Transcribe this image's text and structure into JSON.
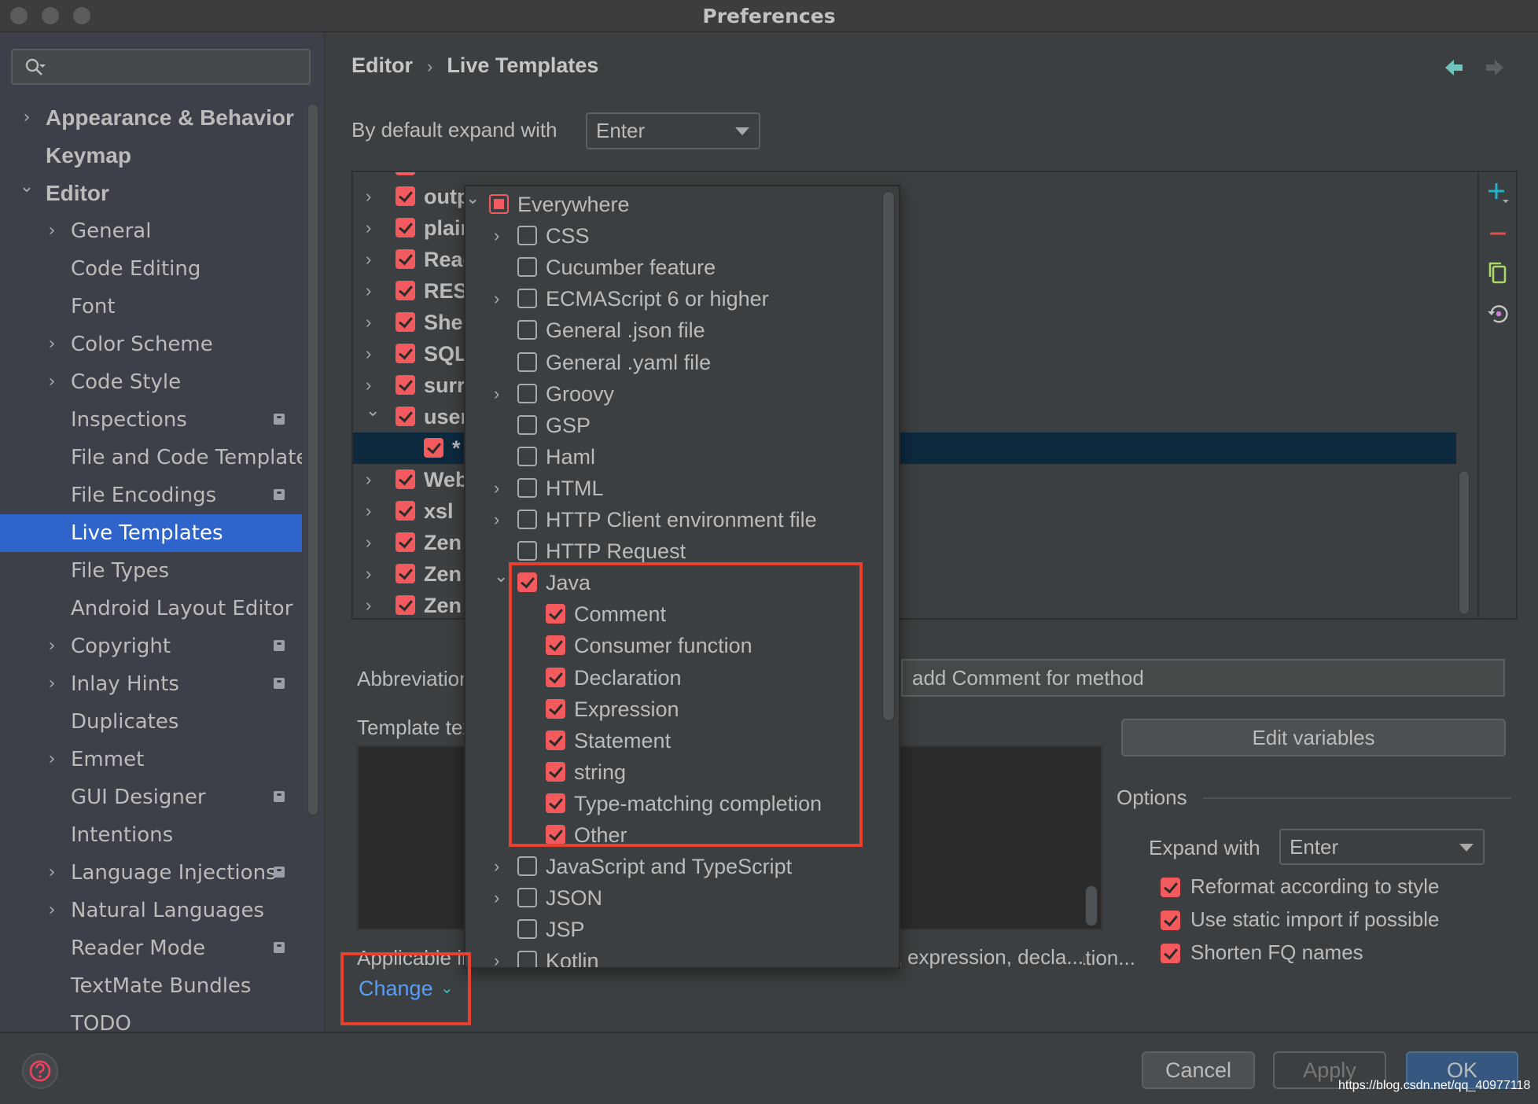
{
  "window": {
    "title": "Preferences"
  },
  "sidebar": {
    "search_placeholder": "",
    "items": [
      {
        "label": "Appearance & Behavior",
        "level": 0,
        "expander": "collapsed",
        "bold": true,
        "badge": false
      },
      {
        "label": "Keymap",
        "level": 0,
        "expander": "none",
        "bold": true,
        "badge": false
      },
      {
        "label": "Editor",
        "level": 0,
        "expander": "expanded",
        "bold": true,
        "badge": false
      },
      {
        "label": "General",
        "level": 1,
        "expander": "collapsed",
        "bold": false,
        "badge": false
      },
      {
        "label": "Code Editing",
        "level": 1,
        "expander": "none",
        "bold": false,
        "badge": false
      },
      {
        "label": "Font",
        "level": 1,
        "expander": "none",
        "bold": false,
        "badge": false
      },
      {
        "label": "Color Scheme",
        "level": 1,
        "expander": "collapsed",
        "bold": false,
        "badge": false
      },
      {
        "label": "Code Style",
        "level": 1,
        "expander": "collapsed",
        "bold": false,
        "badge": false
      },
      {
        "label": "Inspections",
        "level": 1,
        "expander": "none",
        "bold": false,
        "badge": true
      },
      {
        "label": "File and Code Templates",
        "level": 1,
        "expander": "none",
        "bold": false,
        "badge": false
      },
      {
        "label": "File Encodings",
        "level": 1,
        "expander": "none",
        "bold": false,
        "badge": true
      },
      {
        "label": "Live Templates",
        "level": 1,
        "expander": "none",
        "bold": false,
        "badge": false,
        "selected": true
      },
      {
        "label": "File Types",
        "level": 1,
        "expander": "none",
        "bold": false,
        "badge": false
      },
      {
        "label": "Android Layout Editor",
        "level": 1,
        "expander": "none",
        "bold": false,
        "badge": false
      },
      {
        "label": "Copyright",
        "level": 1,
        "expander": "collapsed",
        "bold": false,
        "badge": true
      },
      {
        "label": "Inlay Hints",
        "level": 1,
        "expander": "collapsed",
        "bold": false,
        "badge": true
      },
      {
        "label": "Duplicates",
        "level": 1,
        "expander": "none",
        "bold": false,
        "badge": false
      },
      {
        "label": "Emmet",
        "level": 1,
        "expander": "collapsed",
        "bold": false,
        "badge": false
      },
      {
        "label": "GUI Designer",
        "level": 1,
        "expander": "none",
        "bold": false,
        "badge": true
      },
      {
        "label": "Intentions",
        "level": 1,
        "expander": "none",
        "bold": false,
        "badge": false
      },
      {
        "label": "Language Injections",
        "level": 1,
        "expander": "collapsed",
        "bold": false,
        "badge": true
      },
      {
        "label": "Natural Languages",
        "level": 1,
        "expander": "collapsed",
        "bold": false,
        "badge": false
      },
      {
        "label": "Reader Mode",
        "level": 1,
        "expander": "none",
        "bold": false,
        "badge": true
      },
      {
        "label": "TextMate Bundles",
        "level": 1,
        "expander": "none",
        "bold": false,
        "badge": false
      },
      {
        "label": "TODO",
        "level": 1,
        "expander": "none",
        "bold": false,
        "badge": false
      }
    ]
  },
  "header": {
    "breadcrumb": [
      "Editor",
      "Live Templates"
    ],
    "breadcrumb_separator": "›",
    "nav_back_icon": "arrow-left-icon",
    "nav_forward_icon": "arrow-right-icon"
  },
  "expand_default": {
    "label": "By default expand with",
    "value": "Enter"
  },
  "template_groups": [
    {
      "label": "outp",
      "checked": true,
      "expander": "collapsed"
    },
    {
      "label": "plain",
      "checked": true,
      "expander": "collapsed"
    },
    {
      "label": "Reac",
      "checked": true,
      "expander": "collapsed"
    },
    {
      "label": "REST",
      "checked": true,
      "expander": "collapsed"
    },
    {
      "label": "Shel",
      "checked": true,
      "expander": "collapsed"
    },
    {
      "label": "SQL",
      "checked": true,
      "expander": "collapsed"
    },
    {
      "label": "surr",
      "checked": true,
      "expander": "collapsed"
    },
    {
      "label": "user",
      "checked": true,
      "expander": "expanded"
    },
    {
      "label": "*",
      "checked": true,
      "expander": "none",
      "child": true,
      "selected": true
    },
    {
      "label": "Web",
      "checked": true,
      "expander": "collapsed"
    },
    {
      "label": "xsl",
      "checked": true,
      "expander": "collapsed"
    },
    {
      "label": "Zen",
      "checked": true,
      "expander": "collapsed"
    },
    {
      "label": "Zen",
      "checked": true,
      "expander": "collapsed"
    },
    {
      "label": "Zen",
      "checked": true,
      "expander": "collapsed"
    }
  ],
  "list_toolbar": {
    "add_icon": "plus-icon",
    "remove_icon": "minus-icon",
    "copy_icon": "copy-icon",
    "restore_icon": "restore-icon"
  },
  "editor": {
    "abbreviation_label": "Abbreviation:",
    "description_value": "add Comment for method",
    "template_text_label": "Template text:",
    "template_text_value": "",
    "edit_variables_label": "Edit variables",
    "applicable_label": "Applicable in Java: comment, consumer function, statement, expression, declaration...",
    "applicable_visible_tail": "expression, decla...",
    "change_label": "Change"
  },
  "options": {
    "title": "Options",
    "expand_with_label": "Expand with",
    "expand_with_value": "Enter",
    "checkboxes": [
      {
        "label": "Reformat according to style",
        "checked": true
      },
      {
        "label": "Use static import if possible",
        "checked": true
      },
      {
        "label": "Shorten FQ names",
        "checked": true
      }
    ]
  },
  "context_popup": {
    "items": [
      {
        "label": "Everywhere",
        "level": 0,
        "expander": "expanded",
        "state": "partial"
      },
      {
        "label": "CSS",
        "level": 1,
        "expander": "collapsed",
        "state": "off"
      },
      {
        "label": "Cucumber feature",
        "level": 1,
        "expander": "none",
        "state": "off"
      },
      {
        "label": "ECMAScript 6 or higher",
        "level": 1,
        "expander": "collapsed",
        "state": "off"
      },
      {
        "label": "General .json file",
        "level": 1,
        "expander": "none",
        "state": "off"
      },
      {
        "label": "General .yaml file",
        "level": 1,
        "expander": "none",
        "state": "off"
      },
      {
        "label": "Groovy",
        "level": 1,
        "expander": "collapsed",
        "state": "off"
      },
      {
        "label": "GSP",
        "level": 1,
        "expander": "none",
        "state": "off"
      },
      {
        "label": "Haml",
        "level": 1,
        "expander": "none",
        "state": "off"
      },
      {
        "label": "HTML",
        "level": 1,
        "expander": "collapsed",
        "state": "off"
      },
      {
        "label": "HTTP Client environment file",
        "level": 1,
        "expander": "collapsed",
        "state": "off"
      },
      {
        "label": "HTTP Request",
        "level": 1,
        "expander": "none",
        "state": "off"
      },
      {
        "label": "Java",
        "level": 1,
        "expander": "expanded",
        "state": "on"
      },
      {
        "label": "Comment",
        "level": 2,
        "expander": "none",
        "state": "on"
      },
      {
        "label": "Consumer function",
        "level": 2,
        "expander": "none",
        "state": "on"
      },
      {
        "label": "Declaration",
        "level": 2,
        "expander": "none",
        "state": "on"
      },
      {
        "label": "Expression",
        "level": 2,
        "expander": "none",
        "state": "on"
      },
      {
        "label": "Statement",
        "level": 2,
        "expander": "none",
        "state": "on"
      },
      {
        "label": "string",
        "level": 2,
        "expander": "none",
        "state": "on"
      },
      {
        "label": "Type-matching completion",
        "level": 2,
        "expander": "none",
        "state": "on"
      },
      {
        "label": "Other",
        "level": 2,
        "expander": "none",
        "state": "on"
      },
      {
        "label": "JavaScript and TypeScript",
        "level": 1,
        "expander": "collapsed",
        "state": "off"
      },
      {
        "label": "JSON",
        "level": 1,
        "expander": "collapsed",
        "state": "off"
      },
      {
        "label": "JSP",
        "level": 1,
        "expander": "none",
        "state": "off"
      },
      {
        "label": "Kotlin",
        "level": 1,
        "expander": "collapsed",
        "state": "off"
      }
    ]
  },
  "footer": {
    "cancel_label": "Cancel",
    "apply_label": "Apply",
    "ok_label": "OK",
    "help_icon": "help-icon"
  },
  "watermark": "https://blog.csdn.net/qq_40977118",
  "colors": {
    "accent_selection": "#2f65ca",
    "checkbox_checked": "#f35a5d",
    "annotation_red": "#e8402f",
    "link": "#589df6",
    "ok_button": "#365880",
    "row_selected": "#0d293e"
  }
}
